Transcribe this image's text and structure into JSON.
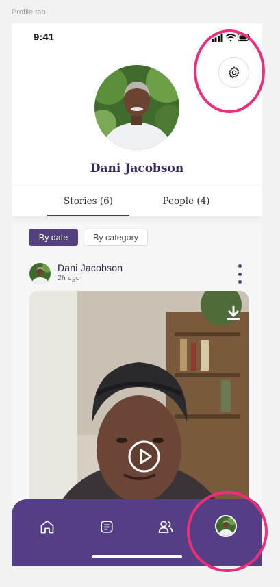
{
  "frame": {
    "label": "Profile tab"
  },
  "status_bar": {
    "time": "9:41"
  },
  "profile": {
    "name": "Dani Jacobson"
  },
  "tabs": [
    {
      "label": "Stories (6)",
      "selected": true
    },
    {
      "label": "People (4)",
      "selected": false
    }
  ],
  "filters": [
    {
      "label": "By date",
      "selected": true
    },
    {
      "label": "By category",
      "selected": false
    }
  ],
  "story": {
    "author": "Dani Jacobson",
    "time": "2h ago"
  },
  "nav": {
    "items": [
      "home-icon",
      "stories-icon",
      "people-icon",
      "profile-avatar"
    ],
    "active": "profile-avatar"
  },
  "colors": {
    "primary": "#543f85",
    "accent_text": "#3a2a5c",
    "highlight_ring": "#ec2f7a",
    "background": "#f6f6f7"
  }
}
